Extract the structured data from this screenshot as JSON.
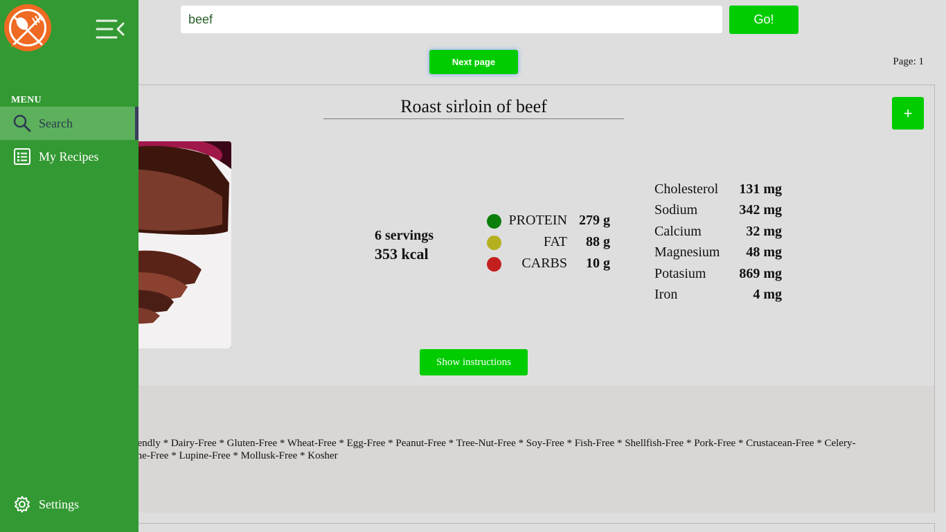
{
  "sidebar": {
    "menu_label": "MENU",
    "items": [
      {
        "label": "Search",
        "icon": "search-icon",
        "active": true
      },
      {
        "label": "My Recipes",
        "icon": "list-icon",
        "active": false
      }
    ],
    "settings_label": "Settings",
    "brand_color": "#339933",
    "logo_color": "#ef6a22"
  },
  "search": {
    "value": "beef",
    "go_label": "Go!"
  },
  "pagination": {
    "next_label": "Next page",
    "page_text": "Page: 1"
  },
  "recipe": {
    "title": "Roast sirloin of beef",
    "add_label": "+",
    "servings": "6 servings",
    "calories": "353 kcal",
    "macros": [
      {
        "name": "PROTEIN",
        "value": "279 g",
        "color": "#0a7f0a"
      },
      {
        "name": "FAT",
        "value": "88 g",
        "color": "#b5b020"
      },
      {
        "name": "CARBS",
        "value": "10 g",
        "color": "#c41f1f"
      }
    ],
    "minerals": [
      {
        "name": "Cholesterol",
        "value": "131 mg"
      },
      {
        "name": "Sodium",
        "value": "342 mg"
      },
      {
        "name": "Calcium",
        "value": "32 mg"
      },
      {
        "name": "Magnesium",
        "value": "48 mg"
      },
      {
        "name": "Potasium",
        "value": "869 mg"
      },
      {
        "name": "Iron",
        "value": "4 mg"
      }
    ],
    "instructions_label": "Show instructions",
    "labels_line1": "Friendly * Dairy-Free * Gluten-Free * Wheat-Free * Egg-Free * Peanut-Free * Tree-Nut-Free * Soy-Free * Fish-Free * Shellfish-Free * Pork-Free * Crustacean-Free * Celery-",
    "labels_line2": "same-Free * Lupine-Free * Mollusk-Free * Kosher"
  },
  "colors": {
    "accent_green": "#00cc00",
    "background": "#dedede"
  }
}
